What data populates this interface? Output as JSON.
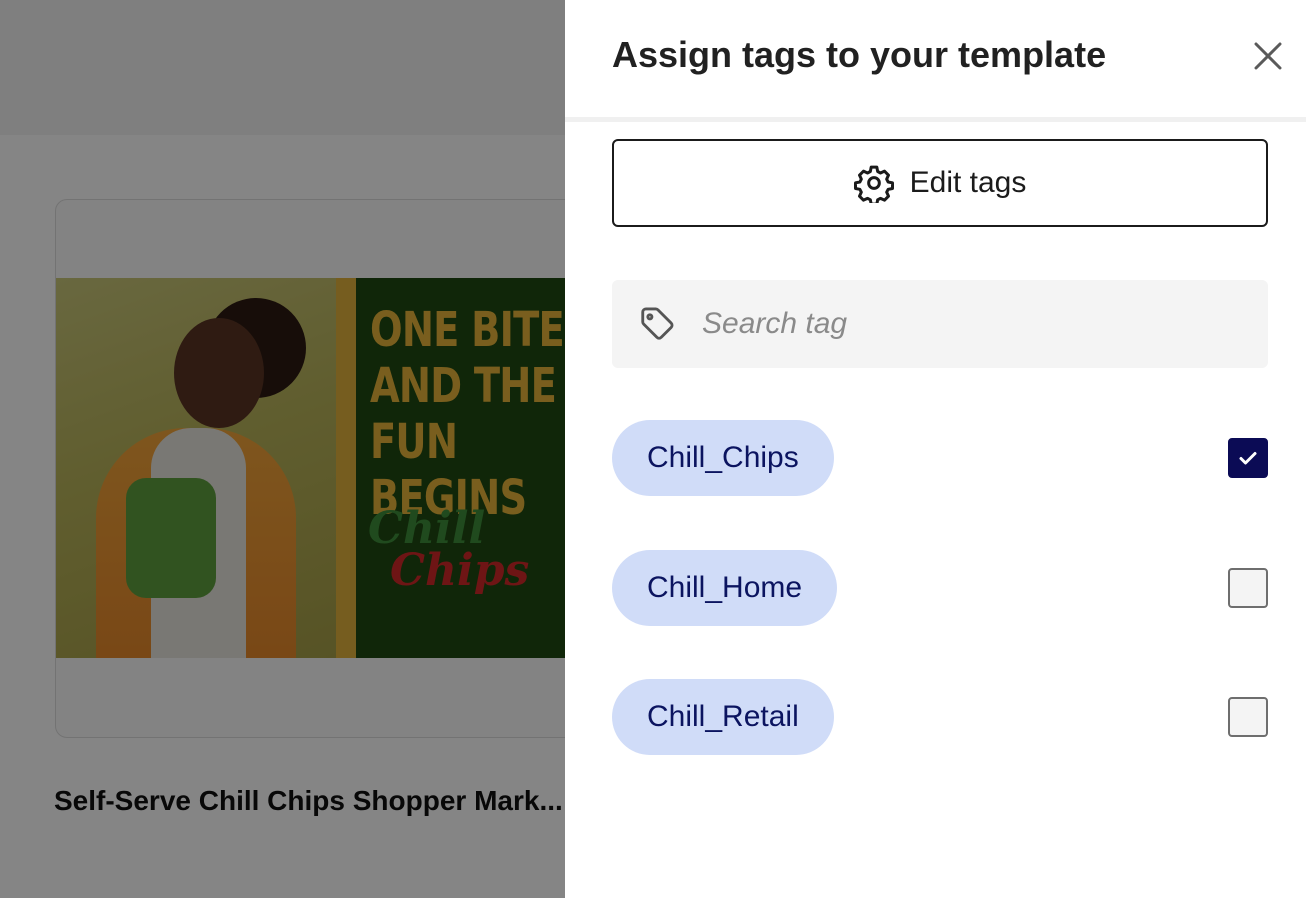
{
  "background": {
    "ad": {
      "headline": "ONE BITE\nAND THE\nFUN\nBEGINS",
      "logo_line1": "Chill",
      "logo_line2": "Chips"
    },
    "template_title": "Self-Serve Chill Chips Shopper Mark..."
  },
  "panel": {
    "title": "Assign tags to your template",
    "close_icon": "close-icon",
    "edit_tags": {
      "label": "Edit tags",
      "icon": "gear-icon"
    },
    "search": {
      "placeholder": "Search tag",
      "value": "",
      "icon": "tag-icon"
    },
    "tags": [
      {
        "label": "Chill_Chips",
        "checked": true
      },
      {
        "label": "Chill_Home",
        "checked": false
      },
      {
        "label": "Chill_Retail",
        "checked": false
      }
    ]
  },
  "colors": {
    "chip_bg": "#d0dcf8",
    "chip_text": "#0b1460",
    "checkbox_checked": "#0b0b55"
  }
}
